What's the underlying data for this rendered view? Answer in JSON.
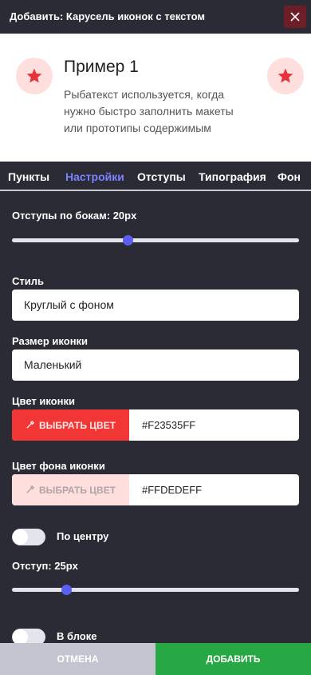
{
  "header": {
    "title": "Добавить: Карусель иконок с текстом",
    "close_icon": "close-icon"
  },
  "preview": {
    "title": "Пример 1",
    "text": "Рыбатекст используется, когда нужно быстро заполнить макеты или прототипы содержимым",
    "icon": "star-icon",
    "icon_color": "#F23535",
    "icon_bg": "#FFDEDE"
  },
  "tabs": [
    {
      "label": "Пункты"
    },
    {
      "label": "Настройки"
    },
    {
      "label": "Отступы"
    },
    {
      "label": "Типография"
    },
    {
      "label": "Фон"
    }
  ],
  "active_tab": "Настройки",
  "settings": {
    "side_padding_label": "Отступы по бокам: 20px",
    "side_padding_level": 0.4,
    "style_label": "Стиль",
    "style_value": "Круглый с фоном",
    "icon_size_label": "Размер иконки",
    "icon_size_value": "Маленький",
    "icon_color_label": "Цвет иконки",
    "pick_color_label": "ВЫБРАТЬ ЦВЕТ",
    "icon_color_value": "#F23535FF",
    "icon_bg_label": "Цвет фона иконки",
    "icon_bg_value": "#FFDEDEFF",
    "center_label": "По центру",
    "center_on": false,
    "offset_label": "Отступ: 25px",
    "offset_level": 0.18,
    "block_label": "В блоке",
    "block_on": false
  },
  "footer": {
    "cancel_label": "ОТМЕНА",
    "add_label": "ДОБАВИТЬ"
  },
  "colors": {
    "accent": "#5B5FF2",
    "tab_active": "#7B82FF",
    "add_button": "#28A745",
    "cancel_button": "#C4C5D0",
    "close_button": "#6D1E27"
  }
}
